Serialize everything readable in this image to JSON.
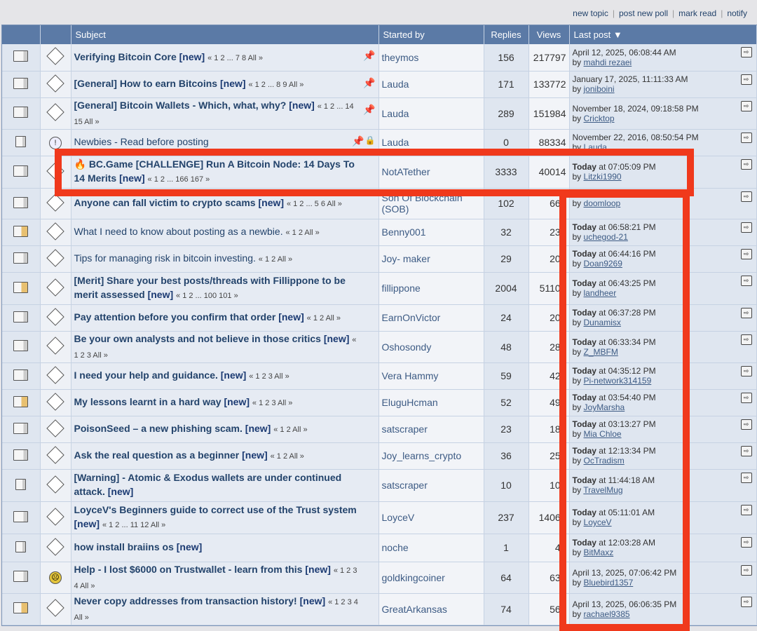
{
  "toolbar": {
    "new_topic": "new topic",
    "new_poll": "post new poll",
    "mark_read": "mark read",
    "notify": "notify"
  },
  "headers": {
    "subject": "Subject",
    "started_by": "Started by",
    "replies": "Replies",
    "views": "Views",
    "last_post": "Last post"
  },
  "rows": [
    {
      "title": "Verifying Bitcoin Core",
      "new": "[new]",
      "pages": "« 1 2 ... 7 8  All »",
      "starter": "theymos",
      "replies": "156",
      "views": "217797",
      "last_time": "April 12, 2025, 06:08:44 AM",
      "last_by": "mahdi rezaei",
      "today": ""
    },
    {
      "title": "[General] How to earn Bitcoins",
      "new": "[new]",
      "pages": "« 1 2 ... 8 9  All »",
      "starter": "Lauda",
      "replies": "171",
      "views": "133772",
      "last_time": "January 17, 2025, 11:11:33 AM",
      "last_by": "joniboini",
      "today": ""
    },
    {
      "title": "[General] Bitcoin Wallets - Which, what, why?",
      "new": "[new]",
      "pages": "« 1 2 ... 14 15  All »",
      "starter": "Lauda",
      "replies": "289",
      "views": "151984",
      "last_time": "November 18, 2024, 09:18:58 PM",
      "last_by": "Cricktop",
      "today": ""
    },
    {
      "title": "Newbies - Read before posting",
      "new": "",
      "pages": "",
      "starter": "Lauda",
      "replies": "0",
      "views": "88334",
      "last_time": "November 22, 2016, 08:50:54 PM",
      "last_by": "Lauda",
      "today": ""
    },
    {
      "title": "🔥 BC.Game [CHALLENGE] Run A Bitcoin Node: 14 Days To 14 Merits",
      "new": "[new]",
      "pages": "« 1 2 ... 166 167 »",
      "starter": "NotATether",
      "replies": "3333",
      "views": "40014",
      "last_time": " at 07:05:09 PM",
      "last_by": "Litzki1990",
      "today": "Today"
    },
    {
      "title": "Anyone can fall victim to crypto scams",
      "new": "[new]",
      "pages": "« 1 2 ... 5 6  All »",
      "starter": "Son Of Blockchain (SOB)",
      "replies": "102",
      "views": "667",
      "last_time": "",
      "last_by": "doomloop",
      "today": ""
    },
    {
      "title": "What I need to know about posting as a newbie.",
      "new": "",
      "pages": "« 1 2  All »",
      "starter": "Benny001",
      "replies": "32",
      "views": "230",
      "last_time": " at 06:58:21 PM",
      "last_by": "uchegod-21",
      "today": "Today"
    },
    {
      "title": "Tips for managing risk in bitcoin investing.",
      "new": "",
      "pages": "« 1 2  All »",
      "starter": "Joy- maker",
      "replies": "29",
      "views": "201",
      "last_time": " at 06:44:16 PM",
      "last_by": "Doan9269",
      "today": "Today"
    },
    {
      "title": "[Merit] Share your best posts/threads with Fillippone to be merit assessed",
      "new": "[new]",
      "pages": "« 1 2 ... 100 101 »",
      "starter": "fillippone",
      "replies": "2004",
      "views": "51102",
      "last_time": " at 06:43:25 PM",
      "last_by": "landheer",
      "today": "Today"
    },
    {
      "title": "Pay attention before you confirm that order",
      "new": "[new]",
      "pages": "« 1 2  All »",
      "starter": "EarnOnVictor",
      "replies": "24",
      "views": "202",
      "last_time": " at 06:37:28 PM",
      "last_by": "Dunamisx",
      "today": "Today"
    },
    {
      "title": "Be your own analysts and not believe in those critics",
      "new": "[new]",
      "pages": "« 1 2 3  All »",
      "starter": "Oshosondy",
      "replies": "48",
      "views": "288",
      "last_time": " at 06:33:34 PM",
      "last_by": "Z_MBFM",
      "today": "Today"
    },
    {
      "title": "I need your help and guidance.",
      "new": "[new]",
      "pages": "« 1 2 3  All »",
      "starter": "Vera Hammy",
      "replies": "59",
      "views": "426",
      "last_time": " at 04:35:12 PM",
      "last_by": "Pi-network314159",
      "today": "Today"
    },
    {
      "title": "My lessons learnt in a hard way",
      "new": "[new]",
      "pages": "« 1 2 3  All »",
      "starter": "EluguHcman",
      "replies": "52",
      "views": "492",
      "last_time": " at 03:54:40 PM",
      "last_by": "JoyMarsha",
      "today": "Today"
    },
    {
      "title": "PoisonSeed – a new phishing scam.",
      "new": "[new]",
      "pages": "« 1 2  All »",
      "starter": "satscraper",
      "replies": "23",
      "views": "189",
      "last_time": " at 03:13:27 PM",
      "last_by": "Mia Chloe",
      "today": "Today"
    },
    {
      "title": "Ask the real question as a beginner",
      "new": "[new]",
      "pages": "« 1 2  All »",
      "starter": "Joy_learns_crypto",
      "replies": "36",
      "views": "259",
      "last_time": " at 12:13:34 PM",
      "last_by": "OcTradism",
      "today": "Today"
    },
    {
      "title": "[Warning] - Atomic & Exodus wallets are under continued attack.",
      "new": "[new]",
      "pages": "",
      "starter": "satscraper",
      "replies": "10",
      "views": "101",
      "last_time": " at 11:44:18 AM",
      "last_by": "TravelMug",
      "today": "Today"
    },
    {
      "title": "LoyceV's Beginners guide to correct use of the Trust system",
      "new": "[new]",
      "pages": "« 1 2 ... 11 12  All »",
      "starter": "LoyceV",
      "replies": "237",
      "views": "14066",
      "last_time": " at 05:11:01 AM",
      "last_by": "LoyceV",
      "today": "Today"
    },
    {
      "title": "how install braiins os",
      "new": "[new]",
      "pages": "",
      "starter": "noche",
      "replies": "1",
      "views": "49",
      "last_time": " at 12:03:28 AM",
      "last_by": "BitMaxz",
      "today": "Today"
    },
    {
      "title": "Help - I lost $6000 on Trustwallet - learn from this",
      "new": "[new]",
      "pages": "« 1 2 3 4  All »",
      "starter": "goldkingcoiner",
      "replies": "64",
      "views": "630",
      "last_time": "April 13, 2025, 07:06:42 PM",
      "last_by": "Bluebird1357",
      "today": ""
    },
    {
      "title": "Never copy addresses from transaction history!",
      "new": "[new]",
      "pages": "« 1 2 3 4  All »",
      "starter": "GreatArkansas",
      "replies": "74",
      "views": "560",
      "last_time": "April 13, 2025, 06:06:35 PM",
      "last_by": "rachael9385",
      "today": ""
    }
  ],
  "colors": {
    "header_bg": "#5b7aa6",
    "accent": "#f0391c",
    "link": "#23436b"
  }
}
